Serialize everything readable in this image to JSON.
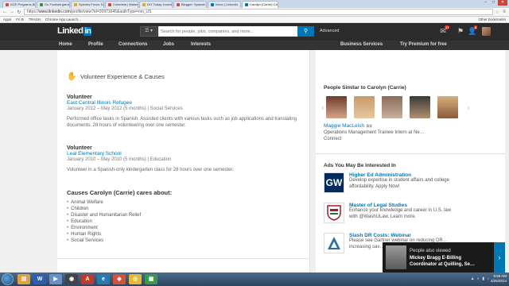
{
  "browser": {
    "tabs": [
      {
        "title": "ACE Programs Br…",
        "color": "#d04a3a"
      },
      {
        "title": "Go Football game list ea…",
        "color": "#3a8d3a"
      },
      {
        "title": "Species Focus Topics fo…",
        "color": "#e2a82c"
      },
      {
        "title": "Colombia | Makerspace C…",
        "color": "#d04a3a"
      },
      {
        "title": "DIY Today Journal – Cam…",
        "color": "#e2a82c"
      },
      {
        "title": "Blogger: Spanish El Blog…",
        "color": "#d04a3a"
      },
      {
        "title": "Inbox | LinkedIn",
        "color": "#0077b5"
      },
      {
        "title": "Carolyn (Carrie) Cassidy…",
        "color": "#0077b5"
      }
    ],
    "url_prefix": "https://",
    "url_host": "www.linkedin.com",
    "url_path": "/profile/view?id=20971645&authType=nm_US",
    "bookmarks": [
      "Apps",
      "Fri B",
      "TRASH",
      "Chrome App Launch…"
    ],
    "other_bookmarks": "Other bookmarks"
  },
  "linkedin": {
    "logo_text": "Linked",
    "logo_in": "in",
    "search_placeholder": "Search for people, jobs, companies, and more...",
    "advanced_label": "Advanced",
    "messages_count": "17",
    "notifications_count": "5",
    "nav": {
      "home": "Home",
      "profile": "Profile",
      "connections": "Connections",
      "jobs": "Jobs",
      "interests": "Interests",
      "business": "Business Services",
      "premium": "Try Premium for free"
    }
  },
  "profile": {
    "section_title": "Volunteer Experience & Causes",
    "entries": [
      {
        "title": "Volunteer",
        "org": "East Central Illinois Refugee",
        "dates": "January 2012 – May 2012 (5 months)  |  Social Services",
        "desc": "Performed office tasks in Spanish. Assisted clients with various tasks such as job applications and translating documents. 28 hours of volunteering over one semester."
      },
      {
        "title": "Volunteer",
        "org": "Leal Elementary School",
        "dates": "January 2010 – May 2010 (5 months)  |  Education",
        "desc": "Volunteer in a Spanish-only kindergarten class for 28 hours over one semester."
      }
    ],
    "causes_title": "Causes Carolyn (Carrie) cares about:",
    "causes": [
      "Animal Welfare",
      "Children",
      "Disaster and Humanitarian Relief",
      "Education",
      "Environment",
      "Human Rights",
      "Social Services"
    ]
  },
  "sidebar": {
    "similar_title": "People Similar to Carolyn (Carrie)",
    "person_name": "Maggie MacLeish",
    "person_degree": "3rd",
    "person_job": "Operations Management Trainee Intern at Ne…",
    "connect_label": "Connect",
    "ads_title": "Ads You May Be Interested In",
    "ads": [
      {
        "logo": "GW",
        "title": "Higher Ed Administration",
        "text": "Develop expertise in student affairs and college affordability. Apply Now!"
      },
      {
        "logo": "",
        "title": "Master of Legal Studies",
        "text": "Enhance your knowledge and career in U.S. law with @WashULaw. Learn more."
      },
      {
        "logo": "",
        "title": "Slash DR Costs: Webinar",
        "text": "Please see Gartner webinar on reducing DR… increasing sav…"
      }
    ]
  },
  "popup": {
    "line1": "People also viewed",
    "line2": "Mickey Bragg E-Billing",
    "line3": "Coordinator at Quilling, Se…"
  },
  "taskbar": {
    "time": "9:59 AM",
    "date": "4/25/2014"
  }
}
